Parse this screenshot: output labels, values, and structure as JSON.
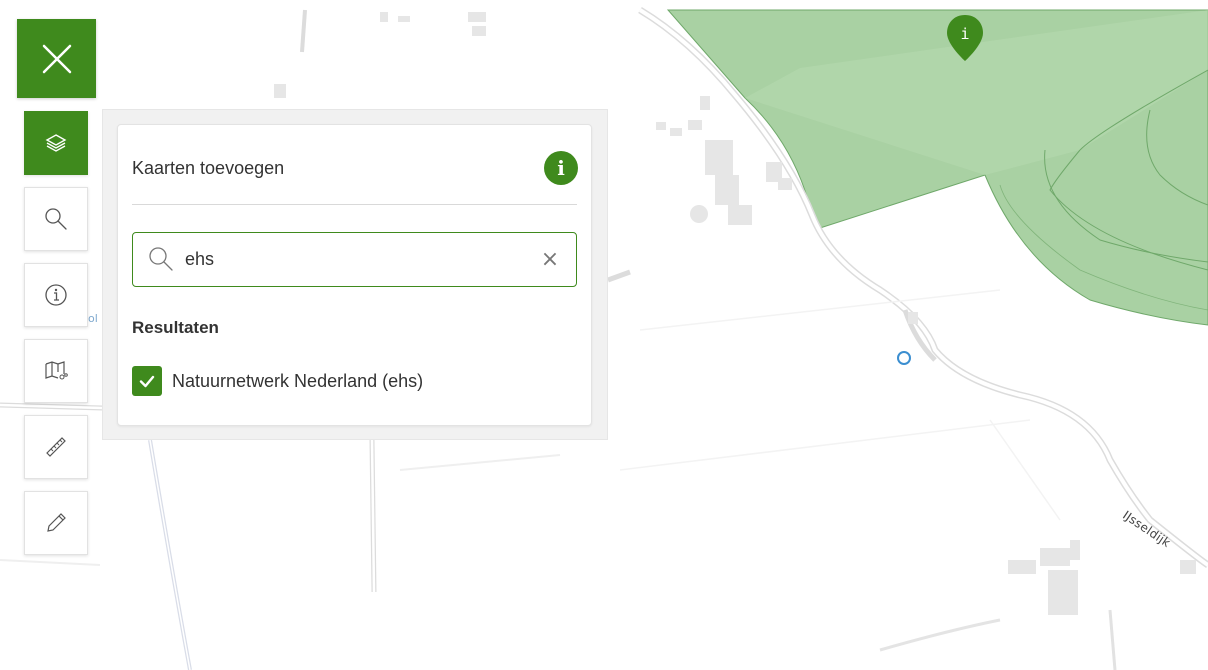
{
  "map": {
    "road_label": "IJsseldijk",
    "marker_label": "i"
  },
  "toolbar": {
    "close_icon": "close-icon",
    "tools": [
      {
        "name": "layers",
        "icon": "layers-icon",
        "active": true
      },
      {
        "name": "search",
        "icon": "search-icon",
        "active": false
      },
      {
        "name": "info",
        "icon": "info-icon",
        "active": false
      },
      {
        "name": "map-compare",
        "icon": "map-compare-icon",
        "active": false
      },
      {
        "name": "measure",
        "icon": "ruler-icon",
        "active": false
      },
      {
        "name": "draw",
        "icon": "pencil-icon",
        "active": false
      }
    ]
  },
  "panel": {
    "title": "Kaarten toevoegen",
    "info_label": "i",
    "search": {
      "value": "ehs",
      "clear_label": "×"
    },
    "results_heading": "Resultaten",
    "results": [
      {
        "label": "Natuurnetwerk Nederland (ehs)",
        "checked": true
      }
    ]
  },
  "colors": {
    "accent": "#3f8a1d",
    "nature_area": "#a9d1a3",
    "nature_border": "#6fa86a"
  }
}
